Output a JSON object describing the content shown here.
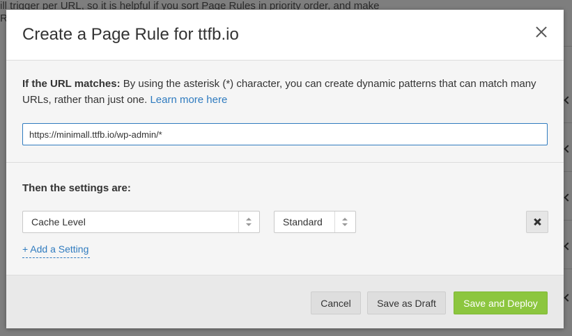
{
  "background": {
    "text_line1": "ill trigger per URL, so it is helpful if you sort Page Rules in priority order, and make",
    "text_line2": "R"
  },
  "modal": {
    "title": "Create a Page Rule for ttfb.io",
    "close_icon": "close-icon"
  },
  "url_section": {
    "label": "If the URL matches:",
    "description": " By using the asterisk (*) character, you can create dynamic patterns that can match many URLs, rather than just one. ",
    "learn_more": "Learn more here",
    "url_value": "https://minimall.ttfb.io/wp-admin/*"
  },
  "settings_section": {
    "label": "Then the settings are:",
    "setting_select": "Cache Level",
    "value_select": "Standard",
    "add_setting": "+ Add a Setting"
  },
  "footer": {
    "cancel": "Cancel",
    "save_draft": "Save as Draft",
    "save_deploy": "Save and Deploy"
  },
  "colors": {
    "accent": "#2f7bbf",
    "primary_button": "#8cc63f"
  }
}
